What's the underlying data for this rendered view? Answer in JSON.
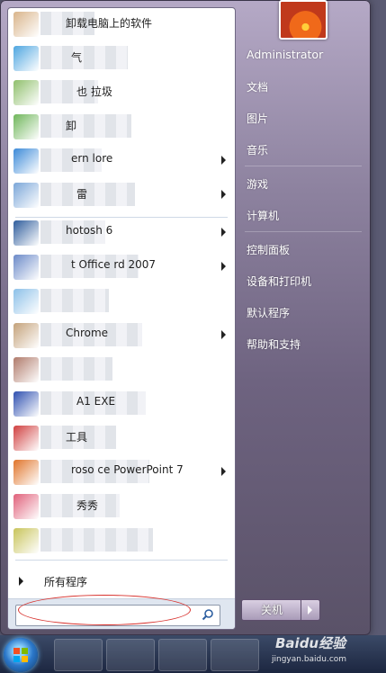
{
  "programs": [
    {
      "label": "卸载电脑上的软件",
      "arrow": false,
      "icon_color": "#d9b48a"
    },
    {
      "label": "气",
      "arrow": false,
      "icon_color": "#4ea6e0"
    },
    {
      "label": "也 拉圾",
      "arrow": false,
      "icon_color": "#8fbf6b"
    },
    {
      "label": "卸",
      "arrow": false,
      "icon_color": "#6fb65a"
    },
    {
      "label": "ern lore",
      "arrow": true,
      "icon_color": "#3c8ad8"
    },
    {
      "label": "雷",
      "arrow": true,
      "icon_color": "#7aa6d8"
    },
    {
      "label": "hotosh 6",
      "arrow": true,
      "icon_color": "#2e5c9c"
    },
    {
      "label": "t Office rd 2007",
      "arrow": true,
      "icon_color": "#6b8ac8"
    },
    {
      "label": "",
      "arrow": false,
      "icon_color": "#8cc0e8"
    },
    {
      "label": "Chrome",
      "arrow": true,
      "icon_color": "#c4a27a"
    },
    {
      "label": "",
      "arrow": false,
      "icon_color": "#b07a6a"
    },
    {
      "label": "A1 EXE",
      "arrow": false,
      "icon_color": "#2e4fb0"
    },
    {
      "label": "工具",
      "arrow": false,
      "icon_color": "#d04040"
    },
    {
      "label": "roso ce PowerPoint 7",
      "arrow": true,
      "icon_color": "#e0742a"
    },
    {
      "label": "秀秀",
      "arrow": false,
      "icon_color": "#e0607a"
    },
    {
      "label": "",
      "arrow": false,
      "icon_color": "#c8c45a"
    }
  ],
  "all_programs_label": "所有程序",
  "search": {
    "placeholder": ""
  },
  "user": {
    "name": "Administrator"
  },
  "right_items": [
    {
      "label": "文档"
    },
    {
      "label": "图片"
    },
    {
      "label": "音乐"
    },
    {
      "label": "游戏"
    },
    {
      "label": "计算机"
    },
    {
      "label": "控制面板"
    },
    {
      "label": "设备和打印机"
    },
    {
      "label": "默认程序"
    },
    {
      "label": "帮助和支持"
    }
  ],
  "shutdown_label": "关机",
  "watermark": {
    "brand": "Baidu经验",
    "url": "jingyan.baidu.com"
  },
  "colors": {
    "highlight_oval": "#d8322e"
  }
}
